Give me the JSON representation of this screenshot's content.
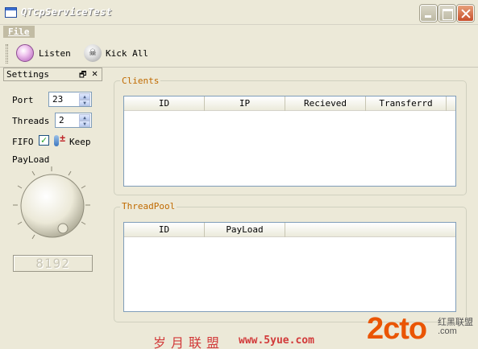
{
  "window": {
    "title": "QTcpServiceTest"
  },
  "menu": {
    "items": [
      "File"
    ]
  },
  "toolbar": {
    "listen_label": "Listen",
    "kick_all_label": "Kick All"
  },
  "settings": {
    "title": "Settings",
    "port_label": "Port",
    "port_value": "23",
    "threads_label": "Threads",
    "threads_value": "2",
    "fifo_label": "FIFO",
    "fifo_checked": true,
    "keep_label": "Keep",
    "payload_label": "PayLoad",
    "payload_lcd": "8192"
  },
  "clients": {
    "legend": "Clients",
    "columns": [
      "ID",
      "IP",
      "Recieved",
      "Transferrd"
    ],
    "rows": []
  },
  "threadpool": {
    "legend": "ThreadPool",
    "columns": [
      "ID",
      "PayLoad"
    ],
    "rows": []
  },
  "watermark": {
    "cn_text": "岁月联盟",
    "url": "www.5yue.com",
    "brand": "2cto",
    "brand_cn": "红黑联盟",
    "brand_url": ".com"
  },
  "colors": {
    "legend": "#c06a00",
    "lcd_digits": "#c9c6b6",
    "accent_orange": "#ea5504"
  }
}
